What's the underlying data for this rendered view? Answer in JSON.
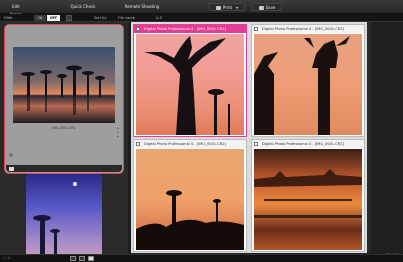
{
  "toolbar": {
    "edit_image": "Edit Image",
    "quick_check": "Quick Check",
    "remote_shooting": "Remote Shooting",
    "print": "Print",
    "save": "Save"
  },
  "filterbar": {
    "filter_label": "Filter",
    "on_label": "ON",
    "off_label": "OFF",
    "sort_label": "Sort by",
    "sort_value": "File name",
    "order_label": "A-Z"
  },
  "browser": {
    "selected_filename": "IMG_0001.CR2"
  },
  "viewer": {
    "cells": [
      {
        "title": "Digital Photo Professional 4 - [IMG_0001.CR2]"
      },
      {
        "title": "Digital Photo Professional 4 - [IMG_0001.CR2]"
      },
      {
        "title": "Digital Photo Professional 4 - [IMG_0001.CR2]"
      },
      {
        "title": "Digital Photo Professional 4 - [IMG_0001.CR2]"
      }
    ],
    "zoom_label": "0/0 / 0/0"
  },
  "statusbar": {
    "text": "1 / 0"
  },
  "colors": {
    "selection": "#e0455d",
    "active_window": "#e23c94"
  },
  "icons": {
    "print": "printer-icon",
    "save": "save-icon"
  }
}
